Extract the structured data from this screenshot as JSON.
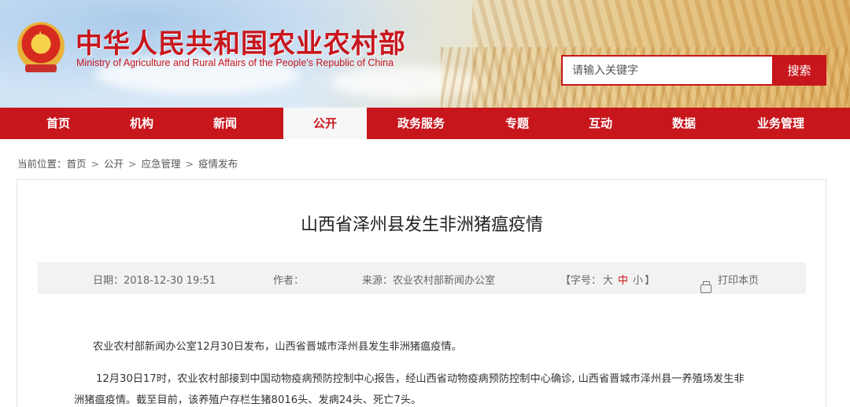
{
  "header": {
    "site_title": "中华人民共和国农业农村部",
    "site_subtitle": "Ministry of Agriculture and Rural Affairs of the People's Republic of China",
    "search": {
      "placeholder": "请输入关键字",
      "button_label": "搜索"
    }
  },
  "nav": {
    "items": [
      {
        "label": "首页"
      },
      {
        "label": "机构"
      },
      {
        "label": "新闻"
      },
      {
        "label": "公开",
        "active": true
      },
      {
        "label": "政务服务"
      },
      {
        "label": "专题"
      },
      {
        "label": "互动"
      },
      {
        "label": "数据"
      },
      {
        "label": "业务管理"
      }
    ]
  },
  "breadcrumb": {
    "prefix": "当前位置：",
    "items": [
      "首页",
      "公开",
      "应急管理",
      "疫情发布"
    ],
    "separator": ">"
  },
  "article": {
    "title": "山西省泽州县发生非洲猪瘟疫情",
    "meta": {
      "date": "日期：2018-12-30 19:51",
      "author": "作者：",
      "source": "来源：农业农村部新闻办公室",
      "font_size_prefix": "【字号：",
      "font_size_large": "大",
      "font_size_medium": "中",
      "font_size_small": "小",
      "font_size_suffix": "】",
      "print_label": "打印本页"
    },
    "paragraphs": [
      "农业农村部新闻办公室12月30日发布，山西省晋城市泽州县发生非洲猪瘟疫情。",
      "12月30日17时，农业农村部接到中国动物疫病预防控制中心报告，经山西省动物疫病预防控制中心确诊, 山西省晋城市泽州县一养殖场发生非",
      "洲猪瘟疫情。截至目前，该养殖户存栏生猪8016头、发病24头、死亡7头。"
    ]
  },
  "colors": {
    "brand_red": "#c8161d",
    "meta_bg": "#f2f2f2"
  }
}
